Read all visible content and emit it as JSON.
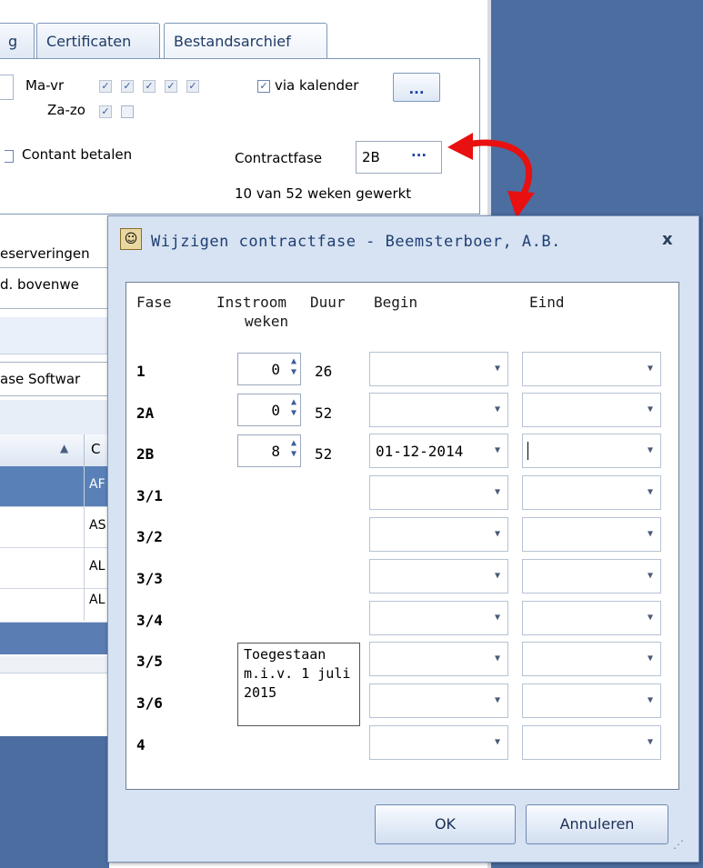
{
  "background_app": {
    "tabs": [
      {
        "label": "g"
      },
      {
        "label": "Certificaten"
      },
      {
        "label": "Bestandsarchief"
      }
    ],
    "schedule": {
      "ma_vr_label": "Ma-vr",
      "za_zo_label": "Za-zo",
      "via_kalender_label": "via kalender",
      "via_kalender_checked": true,
      "dots_button": "..."
    },
    "contant_betalen_label": "Contant betalen",
    "contractfase_label": "Contractfase",
    "contractfase_value": "2B",
    "contractfase_button": "···",
    "weeks_worked": "10 van 52 weken gewerkt",
    "partial_labels": [
      "eserveringen",
      "d. bovenwe",
      "ase Softwar"
    ],
    "grid_header": {
      "sort_icon": "▲",
      "col_c": "C"
    },
    "grid_cells": [
      "AF",
      "AS",
      "AL",
      "AL"
    ],
    "colors": {
      "shell_blue": "#4c6da0",
      "selected_row": "#5a80b8",
      "arrow_red": "#e81010"
    }
  },
  "dialog": {
    "title": "Wijzigen contractfase - Beemsterboer, A.B.",
    "close_glyph": "x",
    "columns": {
      "fase": "Fase",
      "instroom": "Instroom",
      "weken": "weken",
      "duur": "Duur",
      "begin": "Begin",
      "eind": "Eind"
    },
    "rows": [
      {
        "fase": "1",
        "instroom": "0",
        "duur": "26",
        "begin": "",
        "eind": ""
      },
      {
        "fase": "2A",
        "instroom": "0",
        "duur": "52",
        "begin": "",
        "eind": ""
      },
      {
        "fase": "2B",
        "instroom": "8",
        "duur": "52",
        "begin": "01-12-2014",
        "eind": ""
      },
      {
        "fase": "3/1",
        "begin": "",
        "eind": ""
      },
      {
        "fase": "3/2",
        "begin": "",
        "eind": ""
      },
      {
        "fase": "3/3",
        "begin": "",
        "eind": ""
      },
      {
        "fase": "3/4",
        "begin": "",
        "eind": ""
      },
      {
        "fase": "3/5",
        "begin": "",
        "eind": ""
      },
      {
        "fase": "3/6",
        "begin": "",
        "eind": ""
      },
      {
        "fase": "4",
        "begin": "",
        "eind": ""
      }
    ],
    "note_lines": [
      "Toegestaan",
      "m.i.v. 1 juli",
      "2015"
    ],
    "ok_label": "OK",
    "cancel_label": "Annuleren"
  }
}
